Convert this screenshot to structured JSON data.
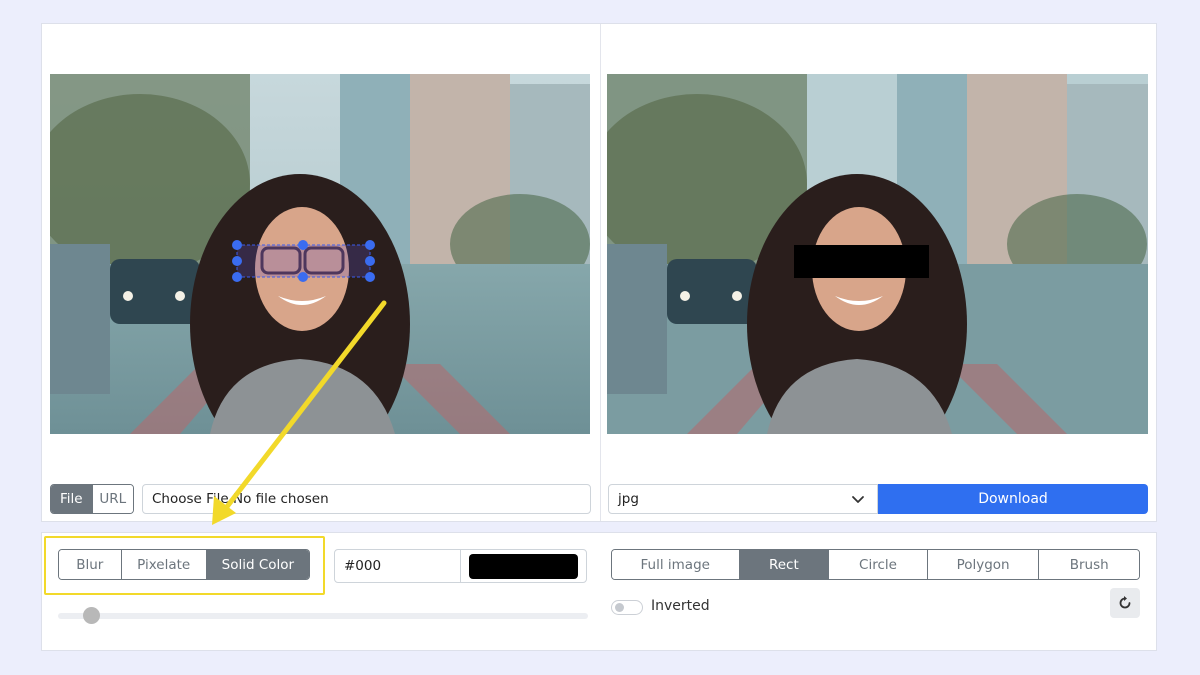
{
  "source": {
    "tabs": [
      {
        "label": "File",
        "active": true
      },
      {
        "label": "URL",
        "active": false
      }
    ],
    "file_button": "Choose File",
    "file_status": "No file chosen"
  },
  "export": {
    "format": "jpg",
    "download_label": "Download",
    "accent": "#2f6ff0"
  },
  "modes": [
    {
      "label": "Blur",
      "active": false
    },
    {
      "label": "Pixelate",
      "active": false
    },
    {
      "label": "Solid Color",
      "active": true
    }
  ],
  "color": {
    "value": "#000",
    "swatch": "#000000"
  },
  "shapes": [
    {
      "label": "Full image",
      "active": false
    },
    {
      "label": "Rect",
      "active": true
    },
    {
      "label": "Circle",
      "active": false
    },
    {
      "label": "Polygon",
      "active": false
    },
    {
      "label": "Brush",
      "active": false
    }
  ],
  "inverted": {
    "label": "Inverted",
    "checked": false
  },
  "strength_slider": {
    "level": 0.06
  },
  "icons": {
    "select_chevron": "chevron-down-icon",
    "reset": "rotate-icon",
    "annotation": "yellow-arrow"
  }
}
